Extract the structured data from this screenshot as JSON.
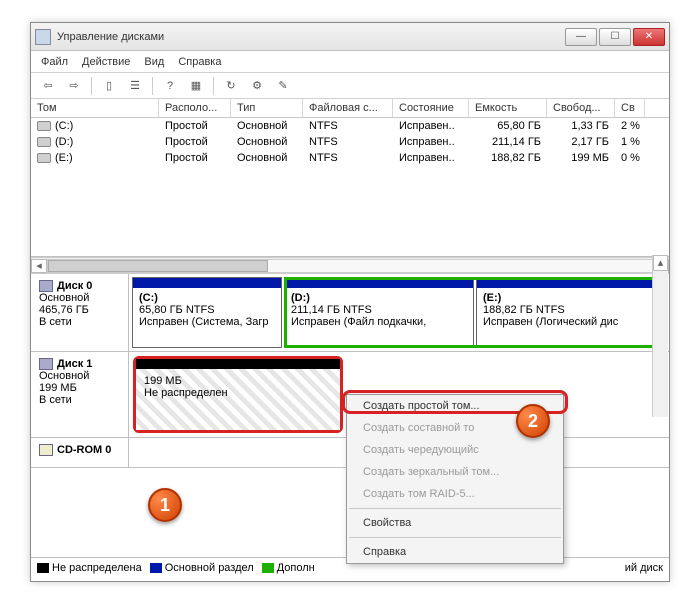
{
  "window": {
    "title": "Управление дисками",
    "ctrl_min": "—",
    "ctrl_max": "☐",
    "ctrl_close": "✕"
  },
  "menu": {
    "file": "Файл",
    "action": "Действие",
    "view": "Вид",
    "help": "Справка"
  },
  "columns": {
    "c0": "Том",
    "c1": "Располо...",
    "c2": "Тип",
    "c3": "Файловая с...",
    "c4": "Состояние",
    "c5": "Емкость",
    "c6": "Свобод...",
    "c7": "Св"
  },
  "volumes": [
    {
      "vol": "(C:)",
      "layout": "Простой",
      "type": "Основной",
      "fs": "NTFS",
      "state": "Исправен..",
      "cap": "65,80 ГБ",
      "free": "1,33 ГБ",
      "pct": "2 %"
    },
    {
      "vol": "(D:)",
      "layout": "Простой",
      "type": "Основной",
      "fs": "NTFS",
      "state": "Исправен..",
      "cap": "211,14 ГБ",
      "free": "2,17 ГБ",
      "pct": "1 %"
    },
    {
      "vol": "(E:)",
      "layout": "Простой",
      "type": "Основной",
      "fs": "NTFS",
      "state": "Исправен..",
      "cap": "188,82 ГБ",
      "free": "199 МБ",
      "pct": "0 %"
    }
  ],
  "disk0": {
    "name": "Диск 0",
    "type": "Основной",
    "size": "465,76 ГБ",
    "status": "В сети",
    "parts": [
      {
        "n": "(C:)",
        "l1": "65,80 ГБ NTFS",
        "l2": "Исправен (Система, Загр"
      },
      {
        "n": "(D:)",
        "l1": "211,14 ГБ NTFS",
        "l2": "Исправен (Файл подкачки,"
      },
      {
        "n": "(E:)",
        "l1": "188,82 ГБ NTFS",
        "l2": "Исправен (Логический дис"
      }
    ]
  },
  "disk1": {
    "name": "Диск 1",
    "type": "Основной",
    "size": "199 МБ",
    "status": "В сети",
    "unalloc_size": "199 МБ",
    "unalloc_label": "Не распределен"
  },
  "cdrom": {
    "name": "CD-ROM 0"
  },
  "legend": {
    "unalloc": "Не распределена",
    "primary": "Основной раздел",
    "ext": "Дополн",
    "logical": "ий диск"
  },
  "ctx": {
    "simple": "Создать простой том...",
    "spanned": "Создать составной то",
    "striped": "Создать чередующийс",
    "mirror": "Создать зеркальный том...",
    "raid5": "Создать том RAID-5...",
    "props": "Свойства",
    "help": "Справка"
  },
  "badges": {
    "b1": "1",
    "b2": "2"
  }
}
